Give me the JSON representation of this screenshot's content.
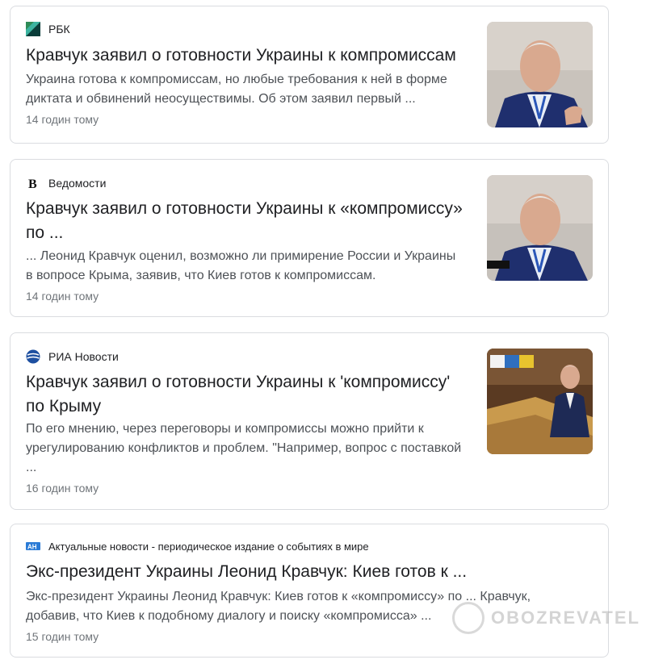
{
  "results": [
    {
      "source": "РБК",
      "title": "Кравчук заявил о готовности Украины к компромиссам",
      "snippet_lines": [
        "Украина готова к компромиссам, но любые требования к ней в форме",
        "диктата и обвинений неосуществимы. Об этом заявил первый ..."
      ],
      "time": "14 годин тому",
      "logo_icon": "rbc-logo-icon"
    },
    {
      "source": "Ведомости",
      "title_lines": [
        "Кравчук заявил о готовности Украины к «компромиссу»",
        "по ..."
      ],
      "snippet_lines": [
        "... Леонид Кравчук оценил, возможно ли примирение России и Украины",
        "в вопросе Крыма, заявив, что Киев готов к компромиссам."
      ],
      "time": "14 годин тому",
      "logo_icon": "vedomosti-logo-icon"
    },
    {
      "source": "РИА Новости",
      "title_lines": [
        "Кравчук заявил о готовности Украины к 'компромиссу'",
        "по Крыму"
      ],
      "snippet_lines": [
        "По его мнению, через переговоры и компромиссы можно прийти к",
        "урегулированию конфликтов и проблем. \"Например, вопрос с поставкой",
        "..."
      ],
      "time": "16 годин тому",
      "logo_icon": "ria-logo-icon"
    },
    {
      "source": "Актуальные новости - периодическое издание о событиях в мире",
      "title": "Экс-президент Украины Леонид Кравчук: Киев готов к ...",
      "snippet_lines": [
        "Экс-президент Украины Леонид Кравчук: Киев готов к «компромиссу» по ... Кравчук,",
        "добавив, что Киев к подобному диалогу и поиску «компромисса» ..."
      ],
      "time": "15 годин тому",
      "logo_icon": "ah-logo-icon"
    }
  ],
  "watermark": "OBOZREVATEL",
  "colors": {
    "title": "#202124",
    "snippet": "#4d5156",
    "time": "#70757a",
    "border": "#dadce0"
  }
}
